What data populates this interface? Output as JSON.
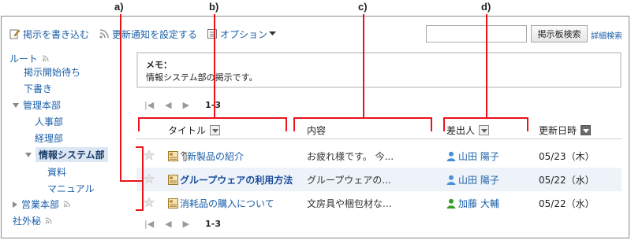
{
  "annotations": [
    "a)",
    "b)",
    "c)",
    "d)"
  ],
  "toolbar": {
    "post_label": "掲示を書き込む",
    "notify_label": "更新通知を設定する",
    "options_label": "オプション",
    "search_value": "",
    "search_button": "掲示板検索",
    "advanced_search": "詳細検索"
  },
  "tree": {
    "root": "ルート",
    "pending": "掲示開始待ち",
    "drafts": "下書き",
    "mgmt": "管理本部",
    "hr": "人事部",
    "accounting": "経理部",
    "infosys": "情報システム部",
    "materials": "資料",
    "manual": "マニュアル",
    "sales": "営業本部",
    "secret": "社外秘"
  },
  "memo": {
    "title": "メモ：",
    "text": "情報システム部の掲示です。"
  },
  "pager": {
    "count": "1-3"
  },
  "columns": {
    "title": "タイトル",
    "content": "内容",
    "sender": "差出人",
    "updated": "更新日時"
  },
  "rows": [
    {
      "title": "新製品の紹介",
      "content": "お疲れ様です。 今...",
      "sender": "山田 陽子",
      "sender_color": "#4a90d9",
      "date": "05/23（木）"
    },
    {
      "title": "グループウェアの利用方法",
      "content": "グループウェアの...",
      "sender": "山田 陽子",
      "sender_color": "#4a90d9",
      "date": "05/22（水）"
    },
    {
      "title": "消耗品の購入について",
      "content": "文房具や梱包材な...",
      "sender": "加藤 大輔",
      "sender_color": "#3a9a2a",
      "date": "05/22（水）"
    }
  ],
  "colors": {
    "accent_red": "#e8141b",
    "link": "#1a5fa8",
    "row_alt": "#eef3fa"
  }
}
